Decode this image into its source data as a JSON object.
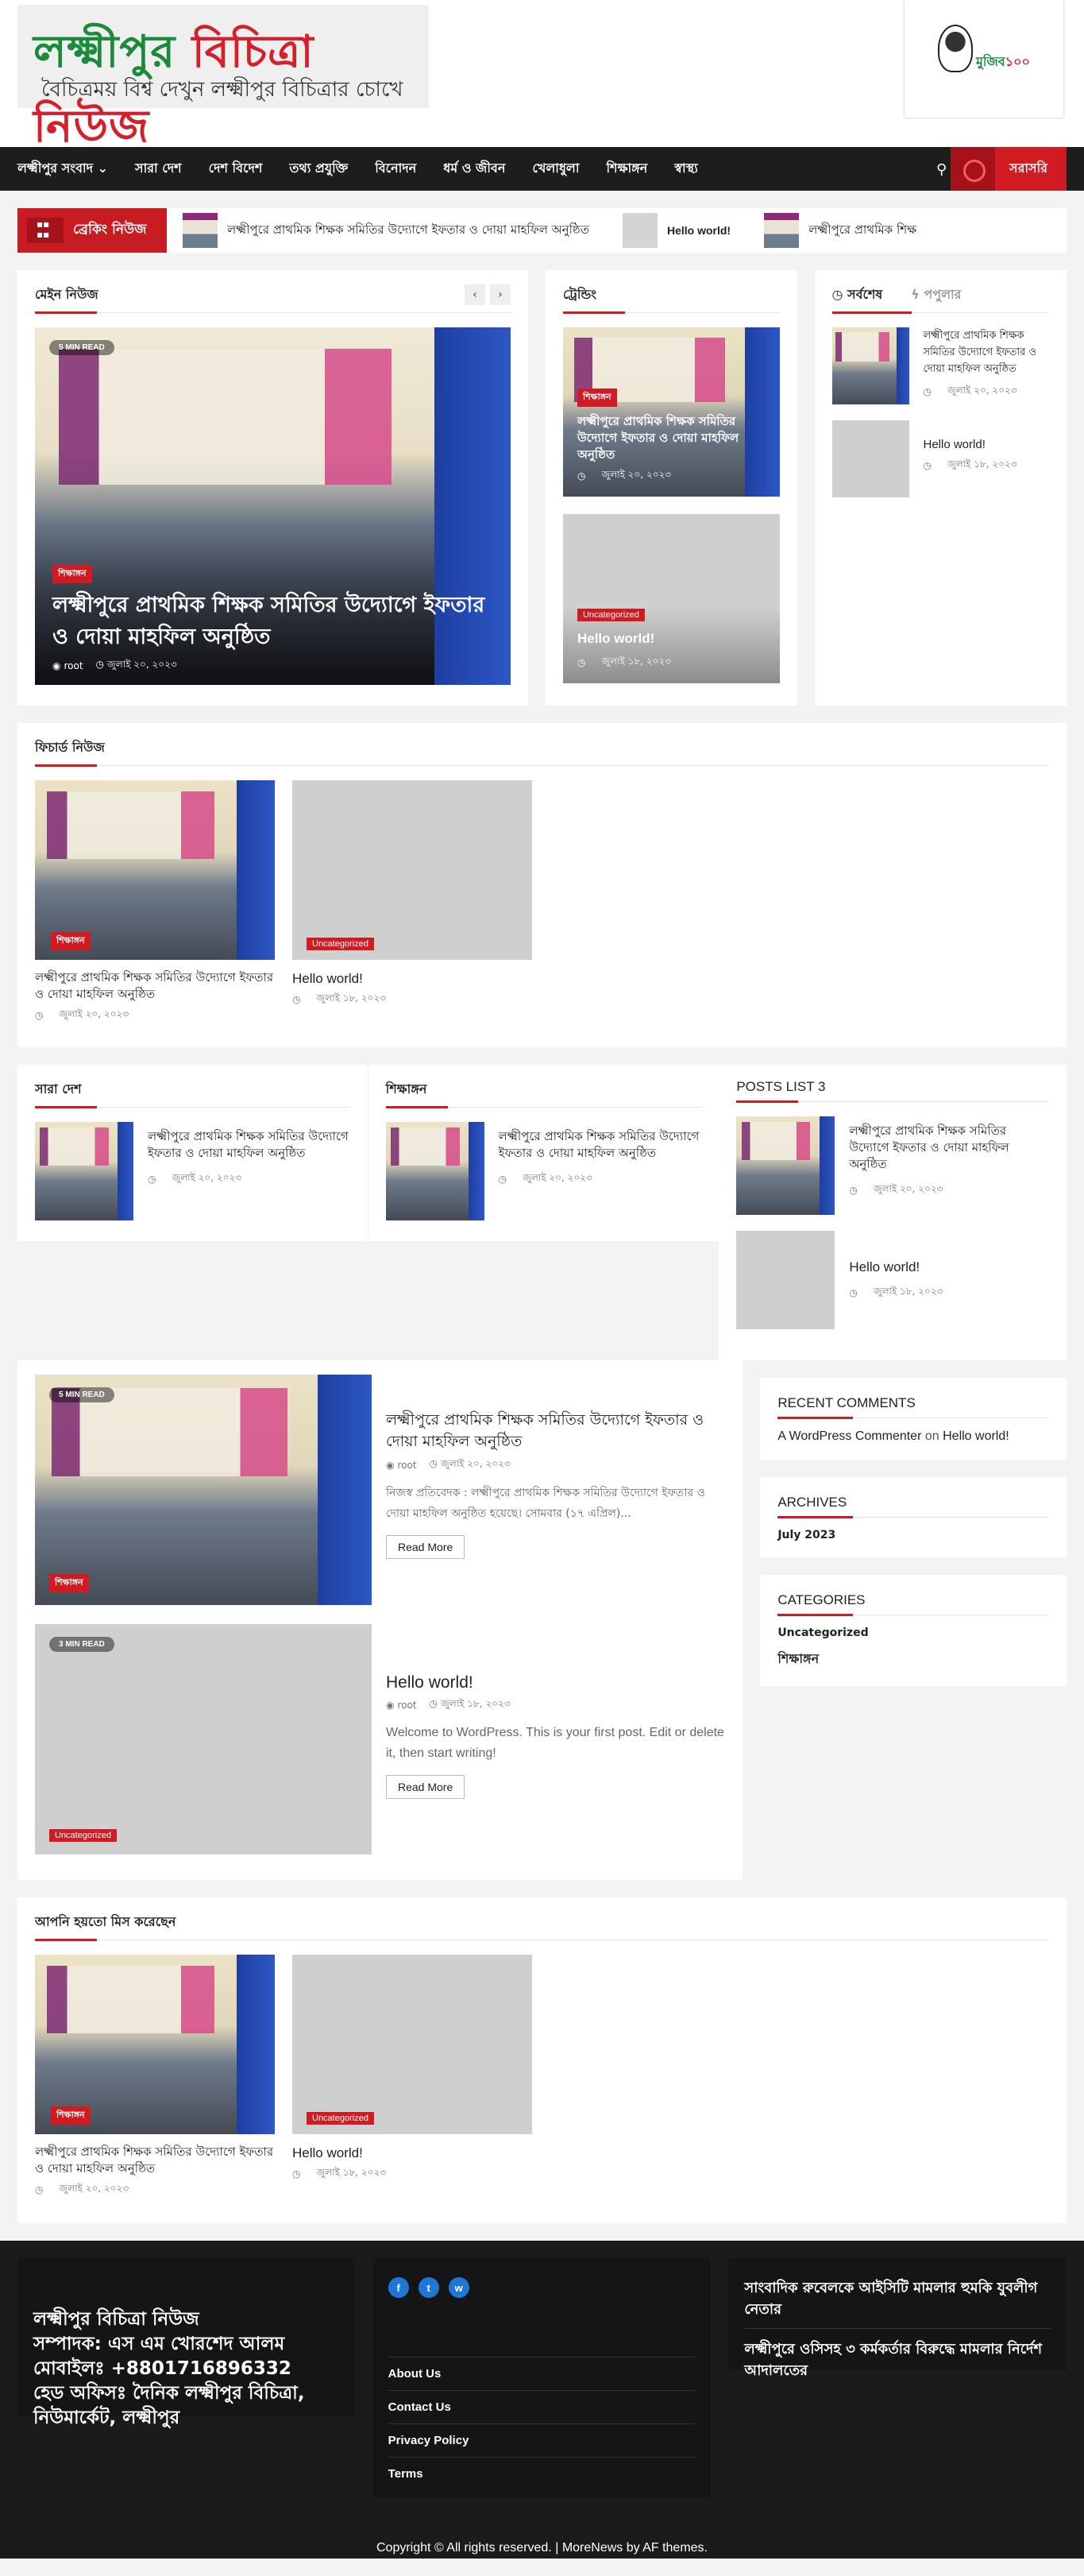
{
  "header": {
    "logo_title_a": "লক্ষ্মীপুর",
    "logo_title_b": "বিচিত্রা নিউজ",
    "logo_tagline": "বৈচিত্রময় বিশ্ব দেখুন লক্ষ্মীপুর বিচিত্রার চোখে",
    "ad_text_a": "মুজিব",
    "ad_text_b": "১০০"
  },
  "nav": {
    "items": [
      "লক্ষ্মীপুর সংবাদ ⌄",
      "সারা দেশ",
      "দেশ বিদেশ",
      "তথ্য প্রযুক্তি",
      "বিনোদন",
      "ধর্ম ও জীবন",
      "খেলাধুলা",
      "শিক্ষাঙ্গন",
      "স্বাস্থ্য"
    ],
    "live_label": "সরাসরি"
  },
  "ticker": {
    "label": "ব্রেকিং নিউজ",
    "items": [
      "লক্ষ্মীপুরে প্রাথমিক শিক্ষক সমিতির উদ্যোগে ইফতার ও দোয়া মাহফিল অনুষ্ঠিত",
      "Hello world!",
      "লক্ষ্মীপুরে প্রাথমিক শিক্ষ"
    ]
  },
  "main_news": {
    "title": "মেইন নিউজ",
    "read_time": "5 MIN READ",
    "category": "শিক্ষাঙ্গন",
    "headline": "লক্ষ্মীপুরে প্রাথমিক শিক্ষক সমিতির উদ্যোগে ইফতার ও দোয়া মাহফিল অনুষ্ঠিত",
    "author": "root",
    "date": "জুলাই ২০, ২০২৩"
  },
  "trending": {
    "title": "ট্রেন্ডিং",
    "posts": [
      {
        "category": "শিক্ষাঙ্গন",
        "headline": "লক্ষ্মীপুরে প্রাথমিক শিক্ষক সমিতির উদ্যোগে ইফতার ও দোয়া মাহফিল অনুষ্ঠিত",
        "date": "জুলাই ২০, ২০২৩"
      },
      {
        "category": "Uncategorized",
        "headline": "Hello world!",
        "date": "জুলাই ১৮, ২০২৩"
      }
    ]
  },
  "tabs": {
    "latest": "সর্বশেষ",
    "popular": "পপুলার",
    "posts": [
      {
        "headline": "লক্ষ্মীপুরে প্রাথমিক শিক্ষক সমিতির উদ্যোগে ইফতার ও দোয়া মাহফিল অনুষ্ঠিত",
        "date": "জুলাই ২০, ২০২৩"
      },
      {
        "headline": "Hello world!",
        "date": "জুলাই ১৮, ২০২৩"
      }
    ]
  },
  "featured": {
    "title": "ফিচার্ড নিউজ",
    "posts": [
      {
        "category": "শিক্ষাঙ্গন",
        "headline": "লক্ষ্মীপুরে প্রাথমিক শিক্ষক সমিতির উদ্যোগে ইফতার ও দোয়া মাহফিল অনুষ্ঠিত",
        "date": "জুলাই ২০, ২০২৩"
      },
      {
        "category": "Uncategorized",
        "headline": "Hello world!",
        "date": "জুলাই ১৮, ২০২৩"
      }
    ]
  },
  "columns": {
    "c1_title": "সারা দেশ",
    "c2_title": "শিক্ষাঙ্গন",
    "c3_title": "POSTS LIST 3",
    "post_headline": "লক্ষ্মীপুরে প্রাথমিক শিক্ষক সমিতির উদ্যোগে ইফতার ও দোয়া মাহফিল অনুষ্ঠিত",
    "post_date": "জুলাই ২০, ২০২৩",
    "hello_headline": "Hello world!",
    "hello_date": "জুলাই ১৮, ২০২৩"
  },
  "archive_list": {
    "posts": [
      {
        "read_time": "5 MIN READ",
        "category": "শিক্ষাঙ্গন",
        "headline": "লক্ষ্মীপুরে প্রাথমিক শিক্ষক সমিতির উদ্যোগে ইফতার ও দোয়া মাহফিল অনুষ্ঠিত",
        "author": "root",
        "date": "জুলাই ২০, ২০২৩",
        "excerpt": "নিজস্ব প্রতিবেদক : লক্ষ্মীপুরে প্রাথমিক শিক্ষক সমিতির উদ্যোগে ইফতার ও দোয়া মাহফিল অনুষ্ঠিত হয়েছে। সোমবার (১৭ এপ্রিল)...",
        "read_more": "Read More"
      },
      {
        "read_time": "3 MIN READ",
        "category": "Uncategorized",
        "headline": "Hello world!",
        "author": "root",
        "date": "জুলাই ১৮, ২০২৩",
        "excerpt": "Welcome to WordPress. This is your first post. Edit or delete it, then start writing!",
        "read_more": "Read More"
      }
    ]
  },
  "sidebar": {
    "recent_comments_title": "RECENT COMMENTS",
    "comment_author": "A WordPress Commenter",
    "comment_on": "on",
    "comment_post": "Hello world!",
    "archives_title": "ARCHIVES",
    "archive_item": "July 2023",
    "categories_title": "CATEGORIES",
    "categories": [
      "Uncategorized",
      "শিক্ষাঙ্গন"
    ]
  },
  "missed": {
    "title": "আপনি হয়তো মিস করেছেন",
    "posts": [
      {
        "category": "শিক্ষাঙ্গন",
        "headline": "লক্ষ্মীপুরে প্রাথমিক শিক্ষক সমিতির উদ্যোগে ইফতার ও দোয়া মাহফিল অনুষ্ঠিত",
        "date": "জুলাই ২০, ২০২৩"
      },
      {
        "category": "Uncategorized",
        "headline": "Hello world!",
        "date": "জুলাই ১৮, ২০২৩"
      }
    ]
  },
  "footer": {
    "about_lines": [
      "লক্ষ্মীপুর বিচিত্রা নিউজ",
      "সম্পাদক: এস এম খোরশেদ আলম",
      "মোবাইলঃ +8801716896332",
      "হেড অফিসঃ দৈনিক লক্ষ্মীপুর বিচিত্রা,",
      "নিউমার্কেট, লক্ষ্মীপুর"
    ],
    "social": [
      "f",
      "t",
      "w"
    ],
    "links": [
      "About Us",
      "Contact Us",
      "Privacy Policy",
      "Terms"
    ],
    "news": [
      "সাংবাদিক রুবেলকে আইসিটি মামলার হুমকি যুবলীগ নেতার",
      "লক্ষ্মীপুরে ওসিসহ ৩ কর্মকর্তার বিরুদ্ধে মামলার নির্দেশ আদালতের"
    ],
    "copyright": "Copyright © All rights reserved. | MoreNews by AF themes."
  }
}
